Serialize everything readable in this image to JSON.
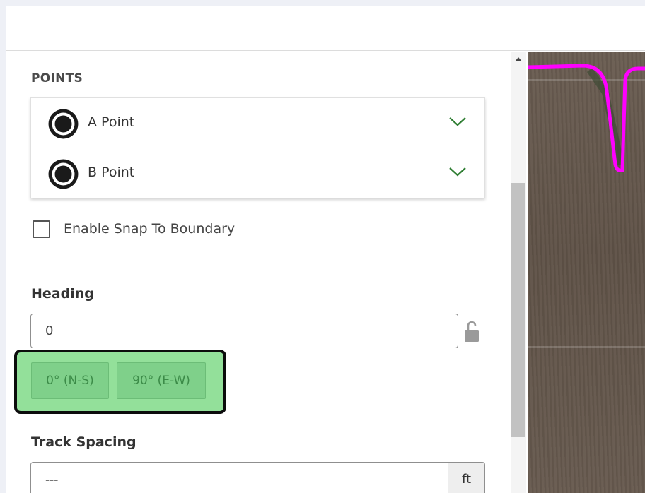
{
  "points": {
    "title": "POINTS",
    "items": [
      {
        "label": "A Point",
        "icon": "target-point-icon"
      },
      {
        "label": "B Point",
        "icon": "target-point-icon"
      }
    ]
  },
  "snap": {
    "label": "Enable Snap To Boundary",
    "checked": false
  },
  "heading": {
    "label": "Heading",
    "value": "0",
    "presets": [
      "0° (N-S)",
      "90° (E-W)"
    ]
  },
  "track_spacing": {
    "label": "Track Spacing",
    "placeholder": "---",
    "unit": "ft"
  },
  "colors": {
    "accent_green": "#2e7d32",
    "highlight": "#93e09a",
    "boundary": "#ff00ff"
  }
}
